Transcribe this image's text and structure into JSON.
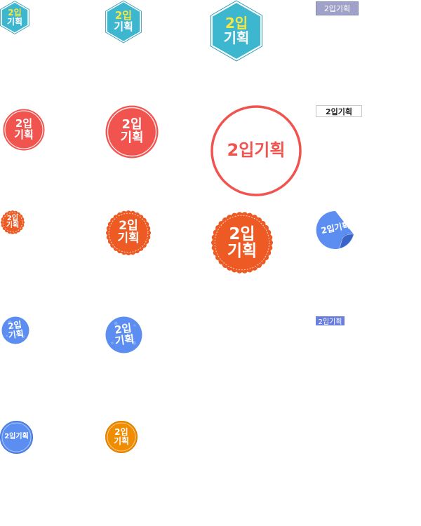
{
  "badges": {
    "teal_small": {
      "top": "2입",
      "bottom": "기획"
    },
    "teal_medium": {
      "top": "2입",
      "bottom": "기획"
    },
    "teal_large": {
      "top": "2입",
      "bottom": "기획"
    },
    "gray_tag": {
      "label": "2입기획"
    },
    "red_small": {
      "top": "2입",
      "bottom": "기획"
    },
    "red_medium": {
      "top": "2입",
      "bottom": "기획"
    },
    "red_outline_large": {
      "label": "2입기획"
    },
    "white_tag": {
      "label": "2입기획"
    },
    "orange_scallop_small": {
      "top": "2입",
      "bottom": "기획"
    },
    "orange_scallop_medium": {
      "top": "2입",
      "bottom": "기획"
    },
    "orange_scallop_large": {
      "top": "2입",
      "bottom": "기획"
    },
    "blue_sticker": {
      "label": "2입기획"
    },
    "blue_grunge_small": {
      "top": "2입",
      "bottom": "기획"
    },
    "blue_grunge_medium": {
      "top": "2입",
      "bottom": "기획"
    },
    "blue_tag": {
      "label": "2입기획"
    },
    "blue_circle": {
      "label": "2입기획"
    },
    "orange_circle": {
      "top": "2입",
      "bottom": "기획"
    }
  },
  "colors": {
    "teal": "#3db7cf",
    "teal_border": "#2a9bb3",
    "yellow_text": "#f5e642",
    "red": "#f1534e",
    "orange_red": "#ee5a24",
    "blue": "#5b8ef0",
    "orange": "#f08c00",
    "gray_tag_bg": "#9fa1c8",
    "blue_tag_bg": "#6a7ee0"
  }
}
